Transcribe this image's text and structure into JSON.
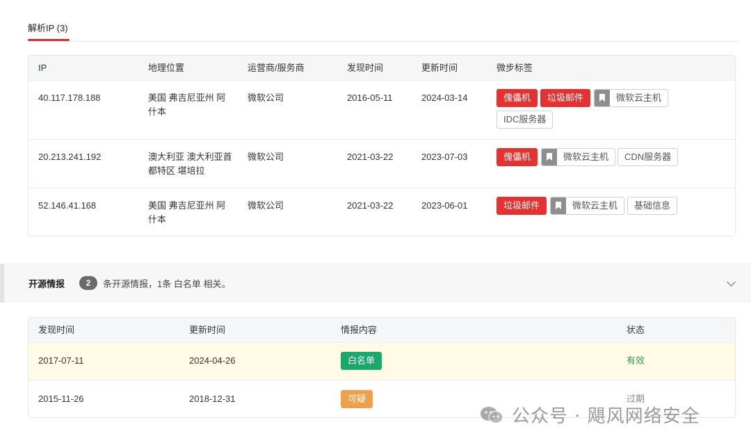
{
  "tab": {
    "label": "解析IP (3)"
  },
  "ip_table": {
    "headers": [
      "IP",
      "地理位置",
      "运营商/服务商",
      "发现时间",
      "更新时间",
      "微步标签"
    ],
    "rows": [
      {
        "ip": "40.117.178.188",
        "geo": "美国 弗吉尼亚州 阿什本",
        "isp": "微软公司",
        "found": "2016-05-11",
        "updated": "2024-03-14",
        "tags": [
          "傀儡机",
          "垃圾邮件",
          "微软云主机",
          "IDC服务器"
        ]
      },
      {
        "ip": "20.213.241.192",
        "geo": "澳大利亚 澳大利亚首都特区 堪培拉",
        "isp": "微软公司",
        "found": "2021-03-22",
        "updated": "2023-07-03",
        "tags": [
          "傀儡机",
          "微软云主机",
          "CDN服务器"
        ]
      },
      {
        "ip": "52.146.41.168",
        "geo": "美国 弗吉尼亚州 阿什本",
        "isp": "微软公司",
        "found": "2021-03-22",
        "updated": "2023-06-01",
        "tags": [
          "垃圾邮件",
          "微软云主机",
          "基础信息"
        ]
      }
    ]
  },
  "intel": {
    "title": "开源情报",
    "count": "2",
    "desc": "条开源情报，1条 白名单 相关。",
    "headers": [
      "发现时间",
      "更新时间",
      "情报内容",
      "状态"
    ],
    "rows": [
      {
        "found": "2017-07-11",
        "updated": "2024-04-26",
        "content": "白名单",
        "status": "有效"
      },
      {
        "found": "2015-11-26",
        "updated": "2018-12-31",
        "content": "可疑",
        "status": "过期"
      }
    ]
  },
  "watermark": "公众号 · 飓风网络安全",
  "colors": {
    "accent_red": "#e5312f",
    "whitelist_green": "#1aa86b",
    "suspicious_orange": "#f0a04b",
    "valid_green": "#2e9b57"
  }
}
